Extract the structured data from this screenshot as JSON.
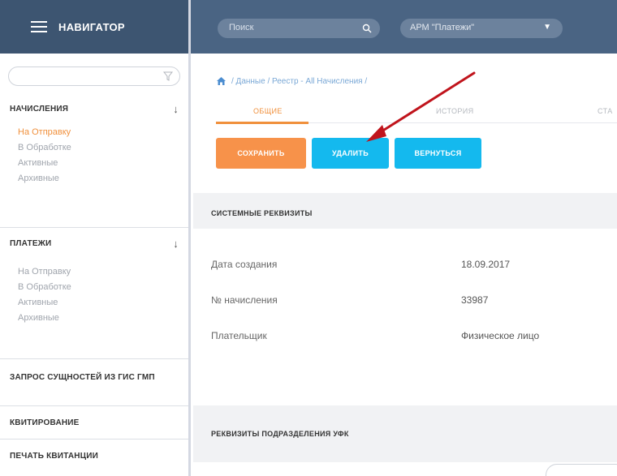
{
  "sidebar": {
    "title": "НАВИГАТОР",
    "sections": [
      {
        "title": "НАЧИСЛЕНИЯ",
        "items": [
          "На Отправку",
          "В Обработке",
          "Активные",
          "Архивные"
        ],
        "active_index": 0
      },
      {
        "title": "ПЛАТЕЖИ",
        "items": [
          "На Отправку",
          "В Обработке",
          "Активные",
          "Архивные"
        ]
      }
    ],
    "links": [
      "ЗАПРОС СУЩНОСТЕЙ ИЗ ГИС ГМП",
      "КВИТИРОВАНИЕ",
      "ПЕЧАТЬ КВИТАНЦИИ"
    ]
  },
  "topbar": {
    "search_placeholder": "Поиск",
    "arm_selected": "АРМ \"Платежи\""
  },
  "breadcrumb": "/ Данные / Реестр - All Начисления /",
  "tabs": [
    "ОБЩИЕ",
    "ИСТОРИЯ",
    "СТА"
  ],
  "buttons": {
    "save": "СОХРАНИТЬ",
    "delete": "УДАЛИТЬ",
    "back": "ВЕРНУТЬСЯ"
  },
  "system_section": {
    "title": "СИСТЕМНЫЕ РЕКВИЗИТЫ",
    "rows": [
      {
        "label": "Дата создания",
        "value": "18.09.2017"
      },
      {
        "label": "№ начисления",
        "value": "33987"
      },
      {
        "label": "Плательщик",
        "value": "Физическое лицо"
      }
    ]
  },
  "ufk_section": {
    "title": "РЕКВИЗИТЫ ПОДРАЗДЕЛЕНИЯ УФК"
  },
  "colors": {
    "sidebar_header": "#3d5571",
    "topbar": "#4a6483",
    "accent_orange": "#f7924a",
    "accent_blue": "#14b9ee",
    "annotation_red": "#c0141c"
  }
}
